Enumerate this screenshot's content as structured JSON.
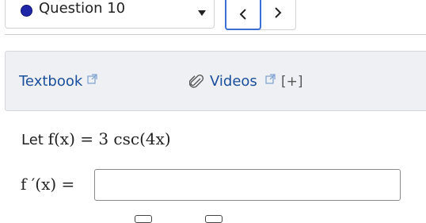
{
  "question_nav": {
    "selected_label": "Question 10",
    "status_color": "#1f26a8",
    "prev_icon": "chevron-left-icon",
    "next_icon": "chevron-right-icon"
  },
  "resources": {
    "textbook_label": "Textbook",
    "videos_label": "Videos",
    "expand_label": "[+]",
    "external_icon": "external-link-icon",
    "attachment_icon": "paperclip-icon"
  },
  "question": {
    "intro_word": "Let",
    "function_text": "f(x) = 3 csc(4x)",
    "answer_label": "f ′(x) =",
    "answer_value": ""
  },
  "colors": {
    "link": "#1a4f9c",
    "focus_outline": "#3b6fd6",
    "panel_bg": "#eff0f3"
  }
}
